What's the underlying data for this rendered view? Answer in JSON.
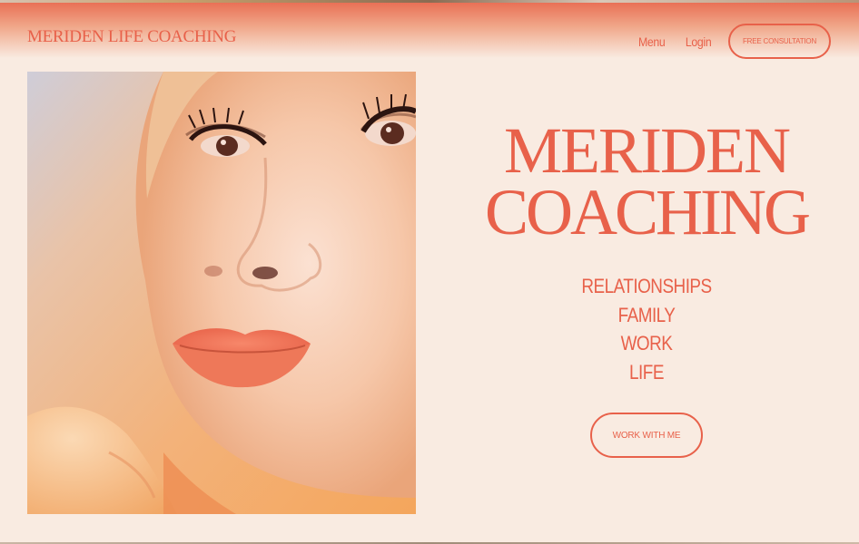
{
  "header": {
    "brand": "MERIDEN LIFE COACHING",
    "nav": {
      "menu": "Menu",
      "login": "Login",
      "cta": "FREE CONSULTATION"
    }
  },
  "hero": {
    "title_line1": "MERIDEN",
    "title_line2": "COACHING",
    "services": [
      "RELATIONSHIPS",
      "FAMILY",
      "WORK",
      "LIFE"
    ],
    "cta": "WORK WITH ME"
  },
  "colors": {
    "accent": "#e8614a",
    "background": "#f9ebe1"
  }
}
